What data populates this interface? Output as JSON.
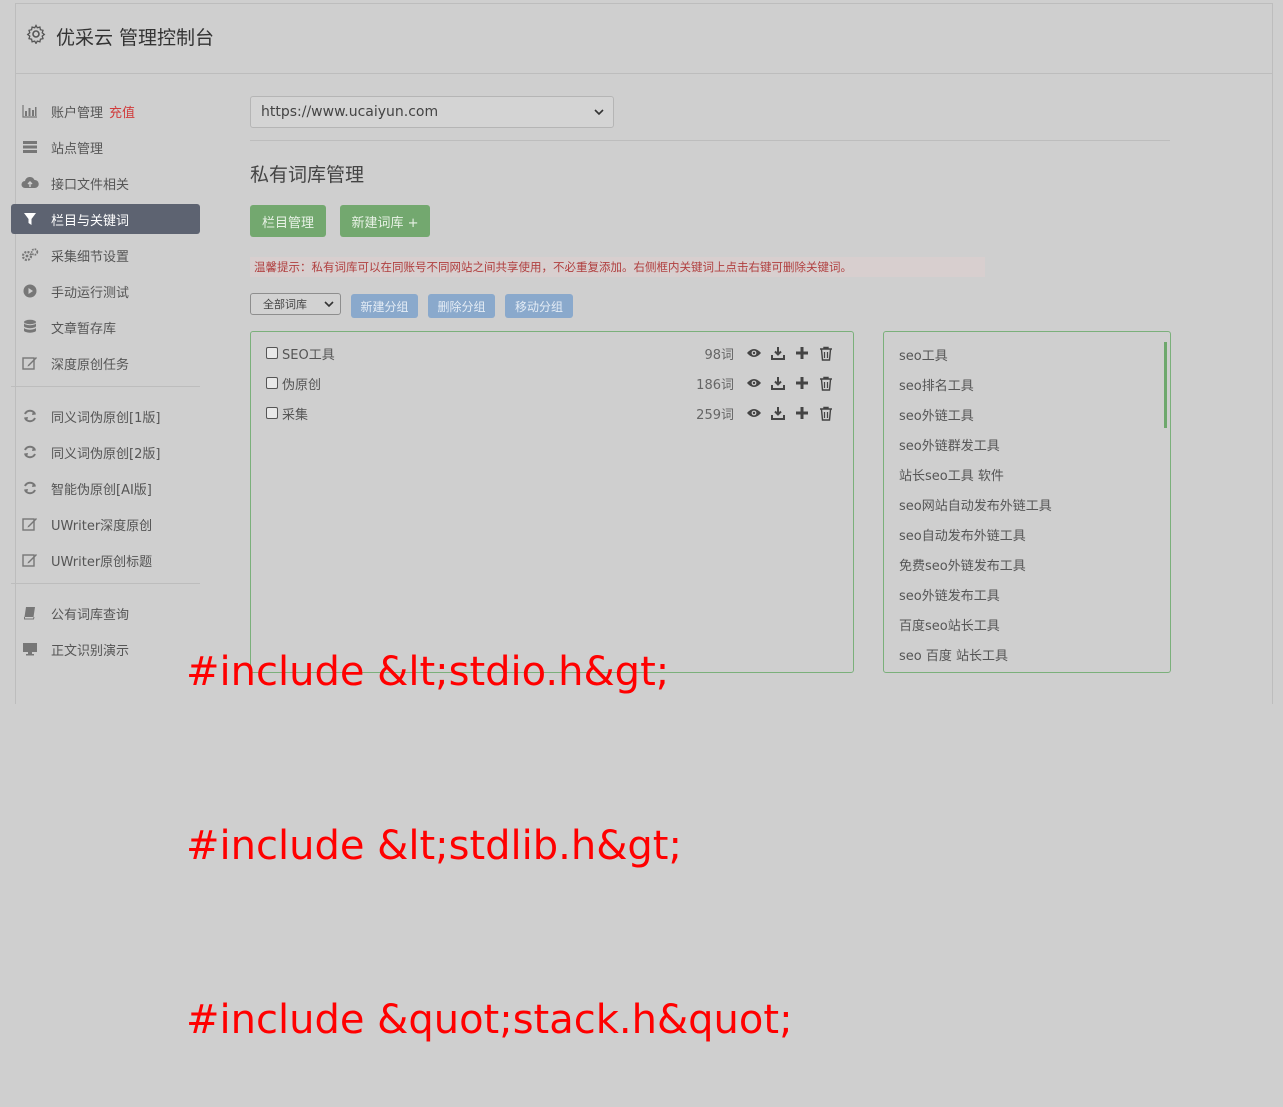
{
  "header": {
    "title": "优采云 管理控制台"
  },
  "sidebar": {
    "items": [
      {
        "label": "账户管理",
        "badge": "充值",
        "icon": "bar-chart-icon"
      },
      {
        "label": "站点管理",
        "icon": "server-icon"
      },
      {
        "label": "接口文件相关",
        "icon": "cloud-upload-icon"
      },
      {
        "label": "栏目与关键词",
        "icon": "filter-icon",
        "active": true
      },
      {
        "label": "采集细节设置",
        "icon": "cogs-icon"
      },
      {
        "label": "手动运行测试",
        "icon": "play-circle-icon"
      },
      {
        "label": "文章暂存库",
        "icon": "database-icon"
      },
      {
        "label": "深度原创任务",
        "icon": "edit-icon"
      }
    ],
    "items2": [
      {
        "label": "同义词伪原创[1版]",
        "icon": "refresh-icon"
      },
      {
        "label": "同义词伪原创[2版]",
        "icon": "refresh-icon"
      },
      {
        "label": "智能伪原创[AI版]",
        "icon": "refresh-icon"
      },
      {
        "label": "UWriter深度原创",
        "icon": "edit-icon"
      },
      {
        "label": "UWriter原创标题",
        "icon": "edit-icon"
      }
    ],
    "items3": [
      {
        "label": "公有词库查询",
        "icon": "book-icon"
      },
      {
        "label": "正文识别演示",
        "icon": "monitor-icon"
      }
    ]
  },
  "main": {
    "site_select": "https://www.ucaiyun.com",
    "page_title": "私有词库管理",
    "btn_columns": "栏目管理",
    "btn_new_lexicon": "新建词库 +",
    "tip": "温馨提示：私有词库可以在同账号不同网站之间共享使用，不必重复添加。右侧框内关键词上点击右键可删除关键词。",
    "group_select": "全部词库",
    "btn_new_group": "新建分组",
    "btn_delete_group": "删除分组",
    "btn_move_group": "移动分组",
    "lexicons": [
      {
        "name": "SEO工具",
        "count": "98词"
      },
      {
        "name": "伪原创",
        "count": "186词"
      },
      {
        "name": "采集",
        "count": "259词"
      }
    ],
    "keywords": [
      "seo工具",
      "seo排名工具",
      "seo外链工具",
      "seo外链群发工具",
      "站长seo工具 软件",
      "seo网站自动发布外链工具",
      "seo自动发布外链工具",
      "免费seo外链发布工具",
      "seo外链发布工具",
      "百度seo站长工具",
      "seo 百度 站长工具"
    ]
  },
  "overlay": {
    "line1": "#include &lt;stdio.h&gt;",
    "line2": "#include &lt;stdlib.h&gt;",
    "line3": "#include &quot;stack.h&quot;"
  }
}
